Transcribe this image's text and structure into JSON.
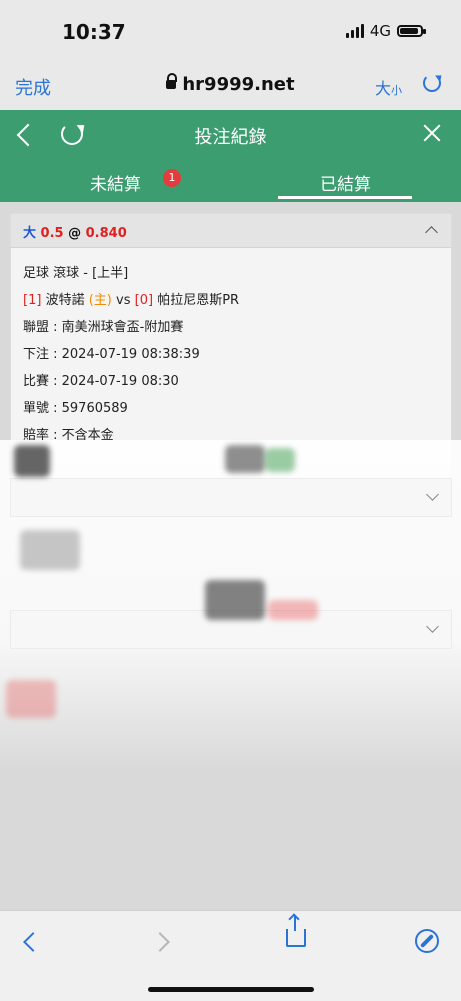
{
  "status": {
    "time": "10:37",
    "network": "4G"
  },
  "browser": {
    "done": "完成",
    "url": "hr9999.net",
    "text_size_big": "大",
    "text_size_small": "小"
  },
  "header": {
    "title": "投注紀錄"
  },
  "tabs": {
    "unsettled": "未結算",
    "unsettled_count": "1",
    "settled": "已結算"
  },
  "bet": {
    "selection": "大",
    "line": "0.5",
    "at": "@",
    "odds": "0.840",
    "sport_line": "足球 滾球 - [上半]",
    "home_score": "[1]",
    "home_team": "波特諾",
    "home_tag": "(主)",
    "vs": "vs",
    "away_score": "[0]",
    "away_team": "帕拉尼恩斯PR",
    "league": "聯盟 : 南美洲球會盃-附加賽",
    "bet_time": "下注 : 2024-07-19 08:38:39",
    "match_time": "比賽 : 2024-07-19 08:30",
    "ticket": "單號 : 59760589",
    "payout_rate": "賠率 : 不含本金"
  },
  "colors": {
    "header_green": "#3c9d70",
    "link_blue": "#2a74d6",
    "badge_red": "#e23c3c"
  }
}
